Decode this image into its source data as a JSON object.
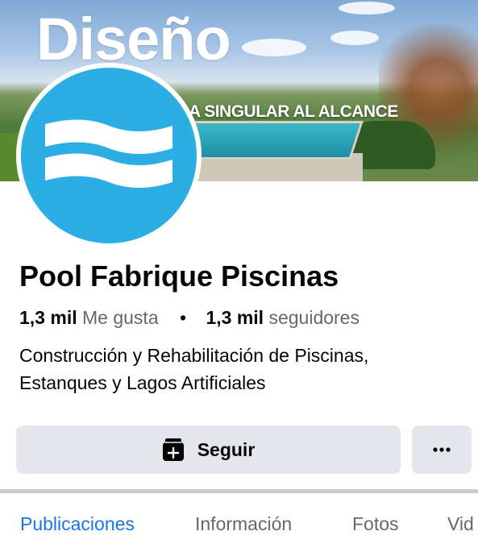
{
  "cover": {
    "title": "Diseño",
    "tagline": "A SINGULAR AL ALCANCE"
  },
  "avatar": {
    "icon": "waves-icon",
    "color": "#2aaee4"
  },
  "page": {
    "name": "Pool Fabrique Piscinas",
    "likes_count": "1,3 mil",
    "likes_label": "Me gusta",
    "separator": "•",
    "followers_count": "1,3 mil",
    "followers_label": "seguidores",
    "category_line1": "Construcción y Rehabilitación de Piscinas,",
    "category_line2": "Estanques y Lagos Artificiales"
  },
  "actions": {
    "follow_label": "Seguir",
    "follow_icon": "follow-icon",
    "more_label": "···"
  },
  "tabs": [
    {
      "label": "Publicaciones",
      "active": true
    },
    {
      "label": "Información",
      "active": false
    },
    {
      "label": "Fotos",
      "active": false
    },
    {
      "label": "Vid",
      "active": false
    }
  ],
  "colors": {
    "accent": "#1b74e4",
    "button_bg": "#e4e6eb",
    "secondary_text": "#65676b"
  }
}
